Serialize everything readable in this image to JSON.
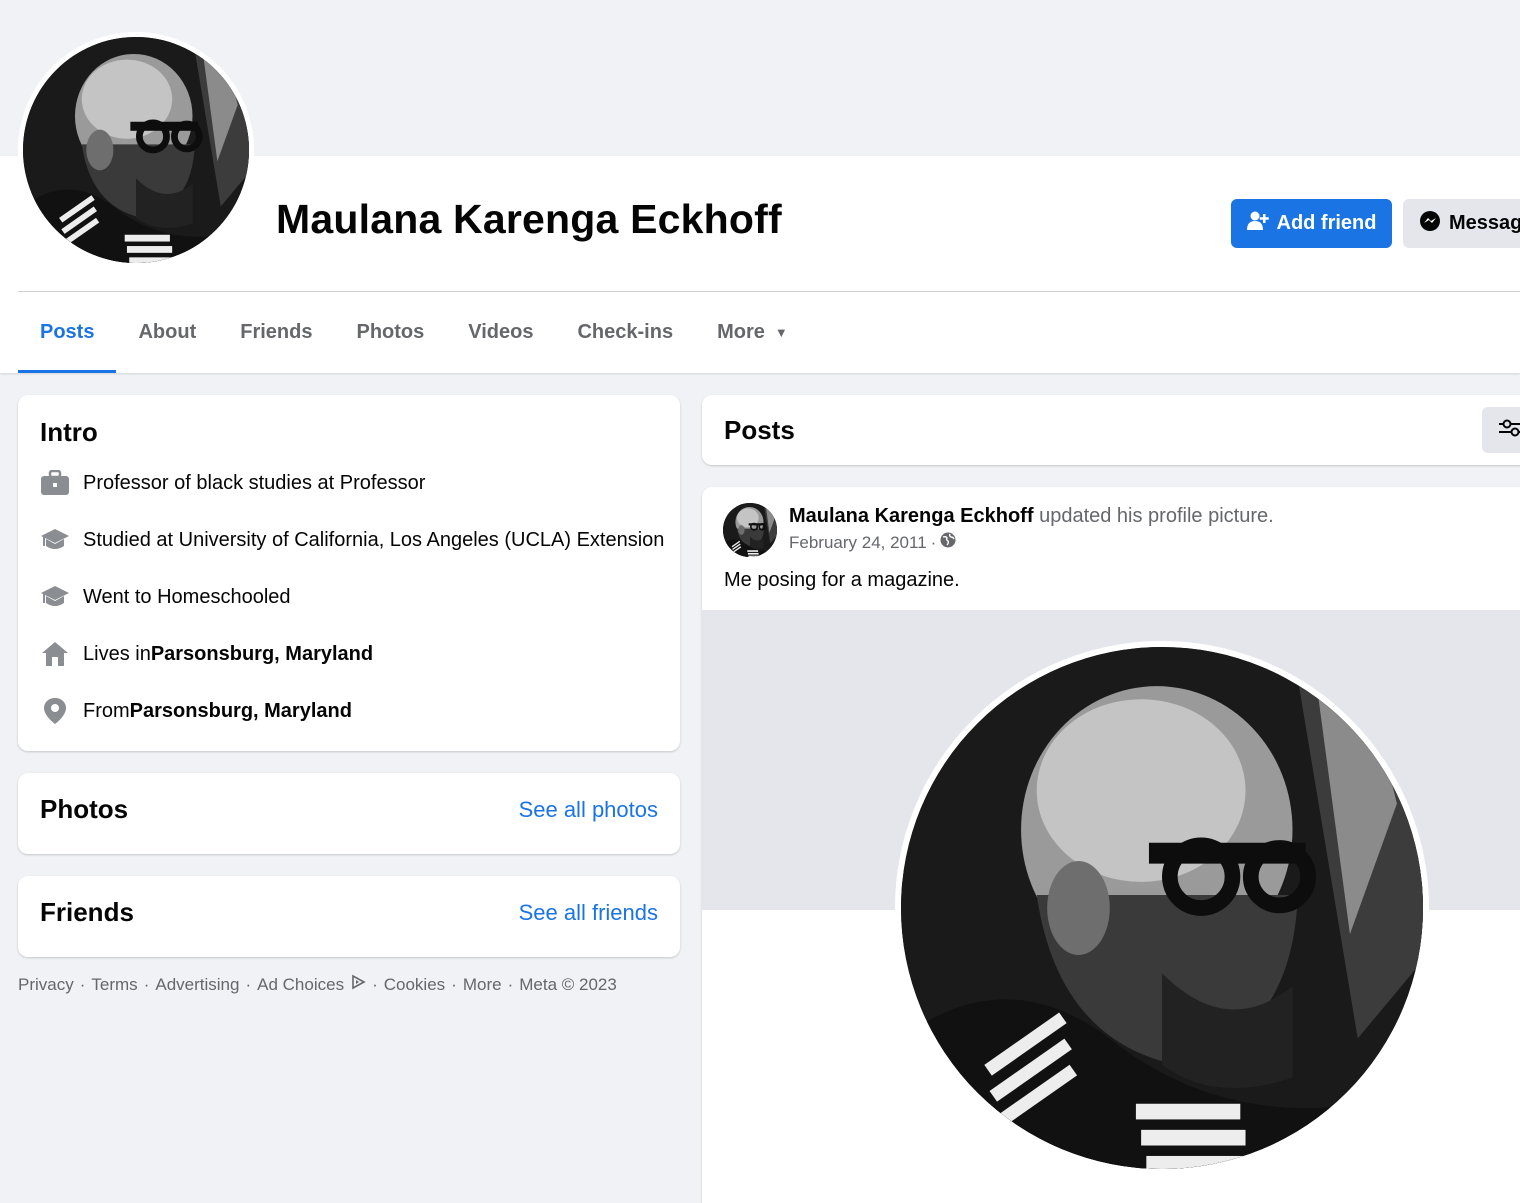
{
  "profile": {
    "name": "Maulana Karenga Eckhoff",
    "add_friend_label": "Add friend",
    "message_label": "Message"
  },
  "tabs": [
    {
      "label": "Posts"
    },
    {
      "label": "About"
    },
    {
      "label": "Friends"
    },
    {
      "label": "Photos"
    },
    {
      "label": "Videos"
    },
    {
      "label": "Check-ins"
    },
    {
      "label": "More"
    }
  ],
  "intro": {
    "title": "Intro",
    "items": [
      {
        "icon": "briefcase-icon",
        "text": "Professor of black studies at Professor"
      },
      {
        "icon": "graduation-cap-icon",
        "text": "Studied at University of California, Los Angeles (UCLA) Extension"
      },
      {
        "icon": "graduation-cap-icon",
        "text": "Went to Homeschooled"
      },
      {
        "icon": "home-icon",
        "prefix": "Lives in ",
        "bold": "Parsonsburg, Maryland"
      },
      {
        "icon": "location-pin-icon",
        "prefix": "From ",
        "bold": "Parsonsburg, Maryland"
      }
    ]
  },
  "photos": {
    "title": "Photos",
    "see_all": "See all photos"
  },
  "friends": {
    "title": "Friends",
    "see_all": "See all friends"
  },
  "footer": {
    "links": [
      "Privacy",
      "Terms",
      "Advertising",
      "Ad Choices",
      "Cookies",
      "More",
      "Meta © 2023"
    ],
    "separator": "·"
  },
  "posts": {
    "title": "Posts",
    "post": {
      "author": "Maulana Karenga Eckhoff",
      "action": "updated his profile picture.",
      "date": "February 24, 2011",
      "date_separator": "·",
      "privacy_icon": "globe-icon",
      "text": "Me posing for a magazine."
    }
  },
  "colors": {
    "accent": "#1b74e4",
    "page_bg": "#f0f2f5",
    "secondary_text": "#65676b"
  }
}
